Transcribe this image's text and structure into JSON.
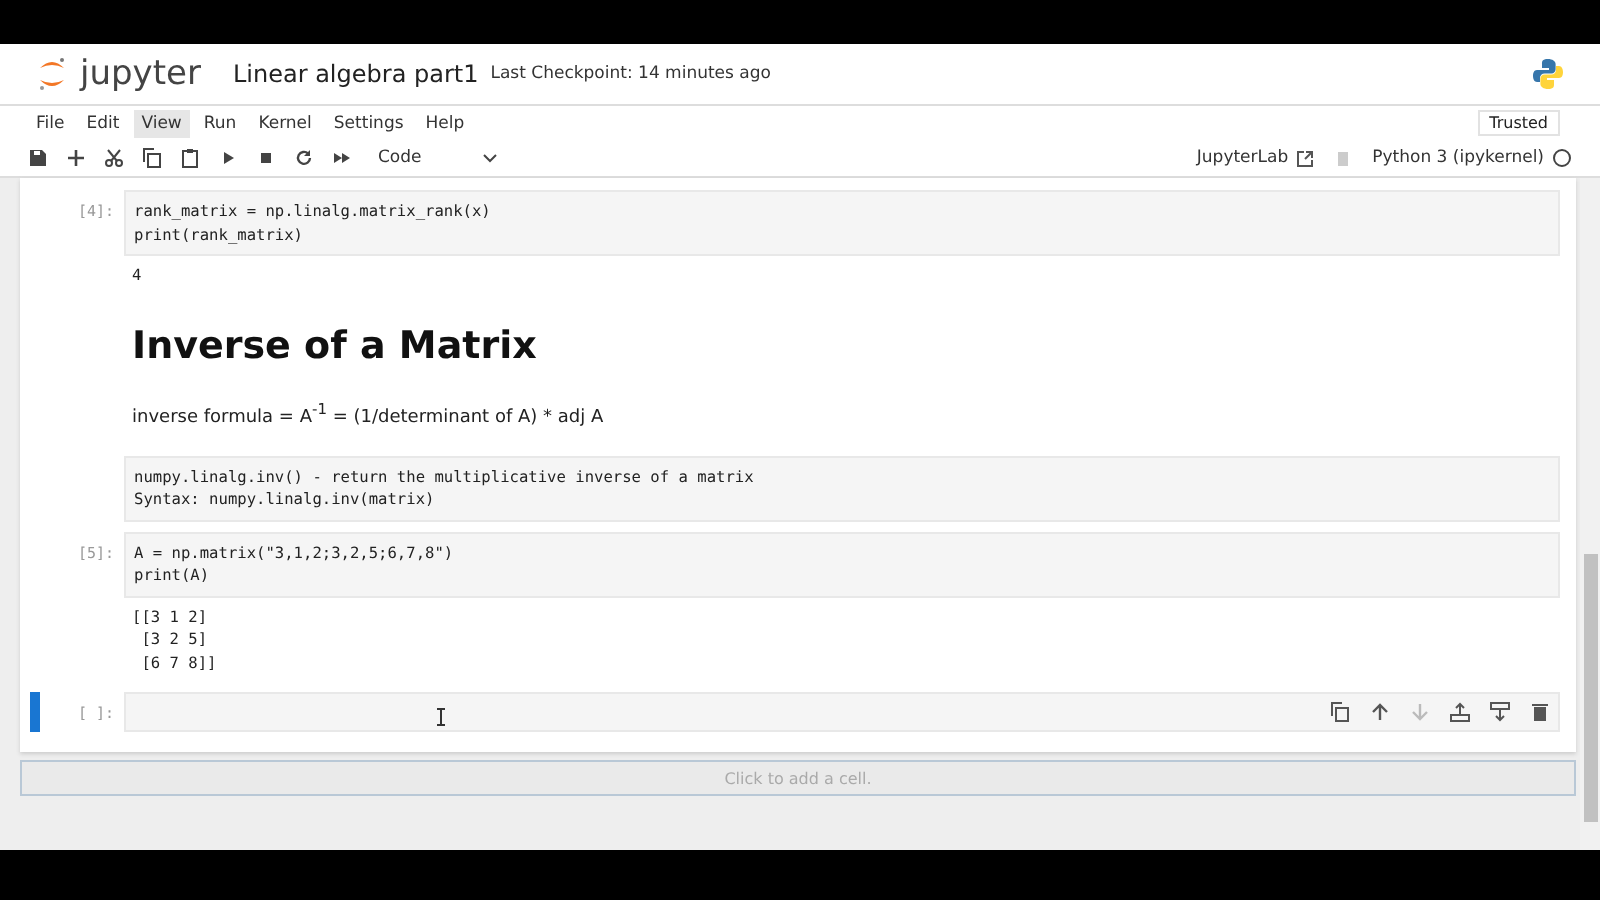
{
  "header": {
    "logo_text": "jupyter",
    "notebook_title": "Linear algebra part1",
    "checkpoint": "Last Checkpoint: 14 minutes ago"
  },
  "menu": [
    {
      "label": "File",
      "selected": false
    },
    {
      "label": "Edit",
      "selected": false
    },
    {
      "label": "View",
      "selected": true
    },
    {
      "label": "Run",
      "selected": false
    },
    {
      "label": "Kernel",
      "selected": false
    },
    {
      "label": "Settings",
      "selected": false
    },
    {
      "label": "Help",
      "selected": false
    }
  ],
  "trusted": "Trusted",
  "toolbar": {
    "cell_type": "Code",
    "jupyterlab_link": "JupyterLab",
    "kernel": "Python 3 (ipykernel)",
    "kernel_busy": false
  },
  "cells": [
    {
      "kind": "code",
      "prompt": "[4]:",
      "source": "rank_matrix = np.linalg.matrix_rank(x)\nprint(rank_matrix)",
      "output": "4",
      "active": false
    },
    {
      "kind": "heading",
      "text": "Inverse of a Matrix"
    },
    {
      "kind": "paragraph",
      "text": "inverse formula = A$^{-1}$ = (1/determinant of A) * adj A"
    },
    {
      "kind": "raw",
      "source": "numpy.linalg.inv() - return the multiplicative inverse of a matrix\nSyntax: numpy.linalg.inv(matrix)"
    },
    {
      "kind": "code",
      "prompt": "[5]:",
      "source": "A = np.matrix(\"3,1,2;3,2,5;6,7,8\")\nprint(A)",
      "output": "[[3 1 2]\n [3 2 5]\n [6 7 8]]",
      "active": false
    },
    {
      "kind": "code",
      "prompt": "[ ]:",
      "active": true
    }
  ],
  "add_cell_hint": "Click to add a cell."
}
